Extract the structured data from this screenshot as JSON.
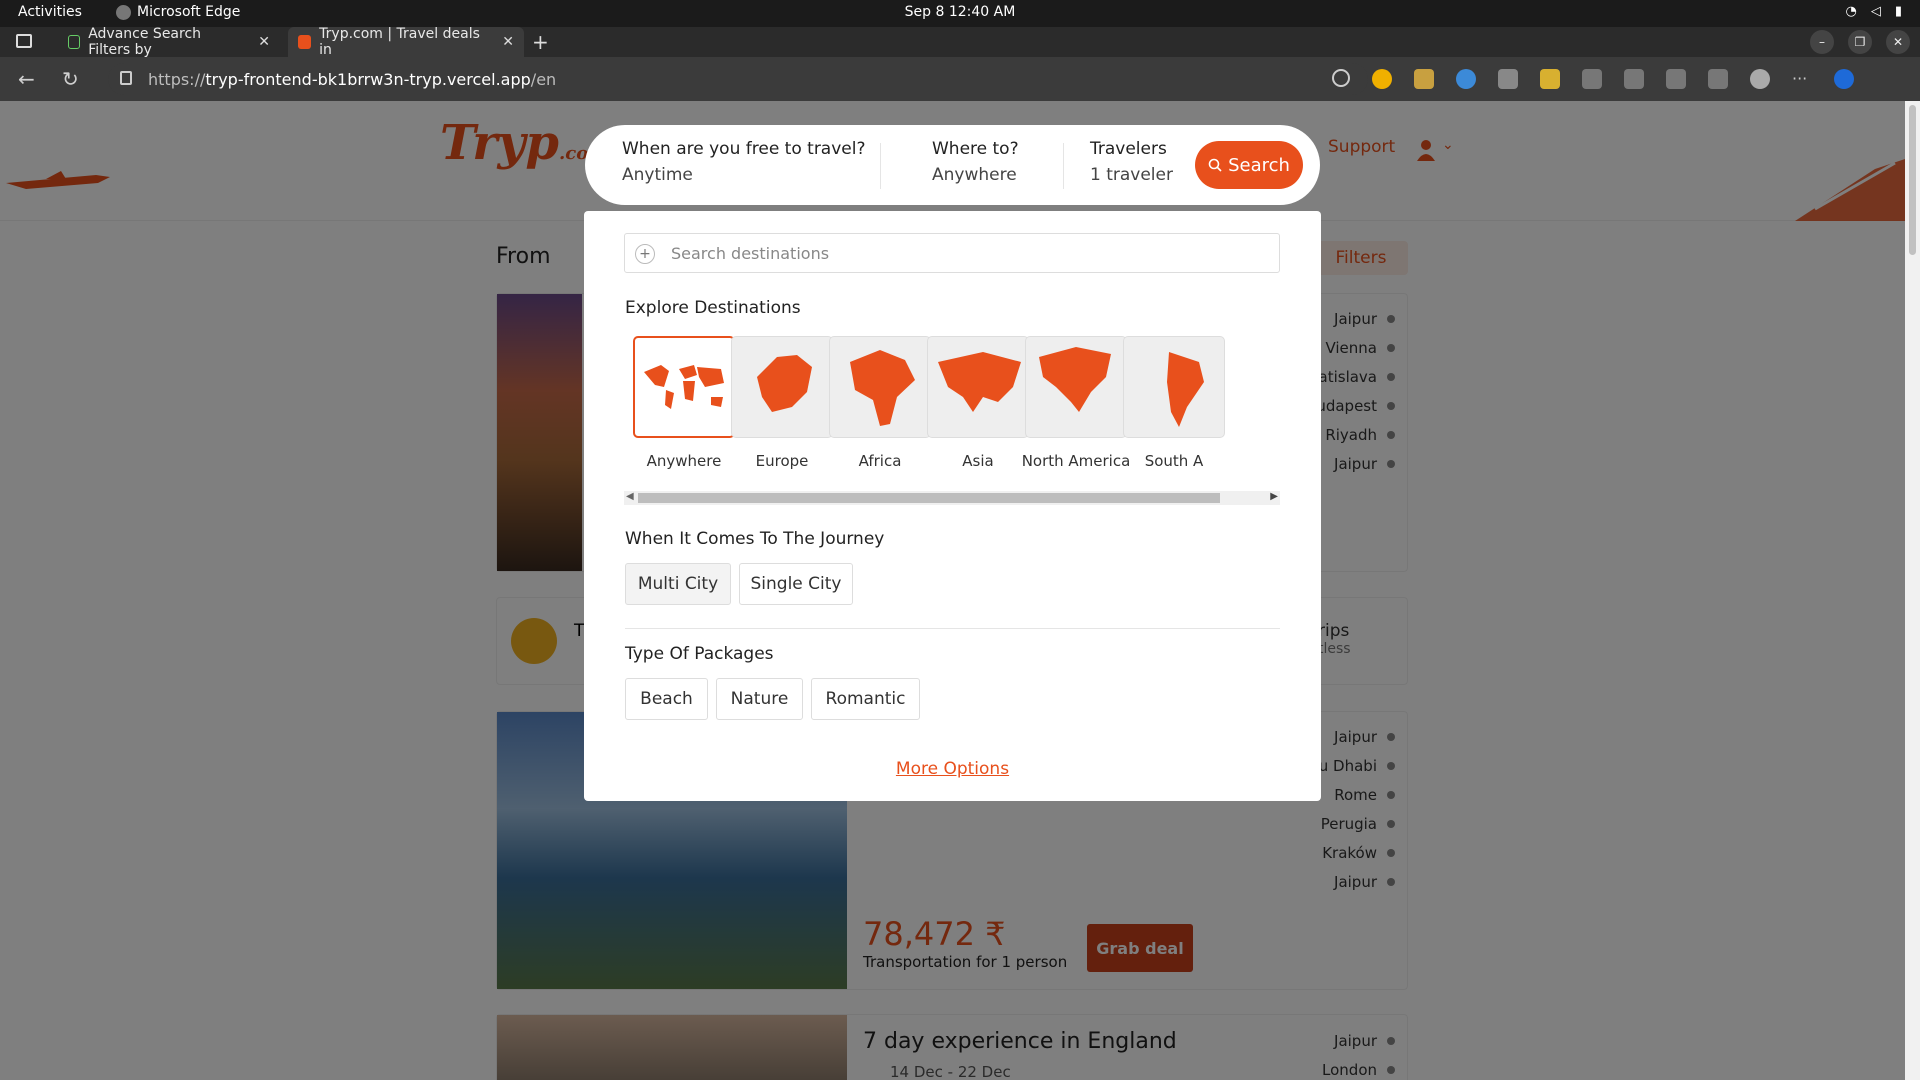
{
  "os": {
    "activities": "Activities",
    "app_name": "Microsoft Edge",
    "clock": "Sep 8  12:40 AM"
  },
  "browser": {
    "tabs": [
      {
        "title": "Advance Search Filters by"
      },
      {
        "title": "Tryp.com | Travel deals in"
      }
    ],
    "url_prefix": "https://",
    "url_host": "tryp-frontend-bk1brrw3n-tryp.vercel.app",
    "url_path": "/en"
  },
  "header": {
    "logo_main": "Tryp",
    "logo_suffix": ".com",
    "support": "Support"
  },
  "search": {
    "when_label": "When are you free to travel?",
    "when_value": "Anytime",
    "where_label": "Where to?",
    "where_value": "Anywhere",
    "travelers_label": "Travelers",
    "travelers_value": "1 traveler",
    "button": "Search"
  },
  "panel": {
    "search_placeholder": "Search destinations",
    "explore_title": "Explore Destinations",
    "regions": [
      {
        "name": "Anywhere",
        "selected": true
      },
      {
        "name": "Europe",
        "selected": false
      },
      {
        "name": "Africa",
        "selected": false
      },
      {
        "name": "Asia",
        "selected": false
      },
      {
        "name": "North America",
        "selected": false
      },
      {
        "name": "South A",
        "selected": false
      }
    ],
    "journey_title": "When It Comes To The Journey",
    "journey_options": [
      "Multi City",
      "Single City"
    ],
    "packages_title": "Type Of Packages",
    "package_options": [
      "Beach",
      "Nature",
      "Romantic"
    ],
    "more_options": "More Options"
  },
  "background": {
    "from_label": "From",
    "filters": "Filters",
    "card1_stops": [
      "Jaipur",
      "Vienna",
      "atislava",
      "udapest",
      "Riyadh",
      "Jaipur"
    ],
    "banner_letter": "T",
    "banner_trips": "rips",
    "banner_sub": "tless",
    "card2_stops": [
      "Jaipur",
      "u Dhabi",
      "Rome",
      "Perugia",
      "Kraków",
      "Jaipur"
    ],
    "price": "78,472 ₹",
    "price_note": "Transportation for 1 person",
    "grab_deal": "Grab deal",
    "card3_title": "7 day experience in England",
    "card3_date": "14 Dec - 22 Dec",
    "card3_stops": [
      "Jaipur",
      "London"
    ]
  },
  "colors": {
    "brand": "#e8501c",
    "overlay": "rgba(0,0,0,0.5)"
  }
}
